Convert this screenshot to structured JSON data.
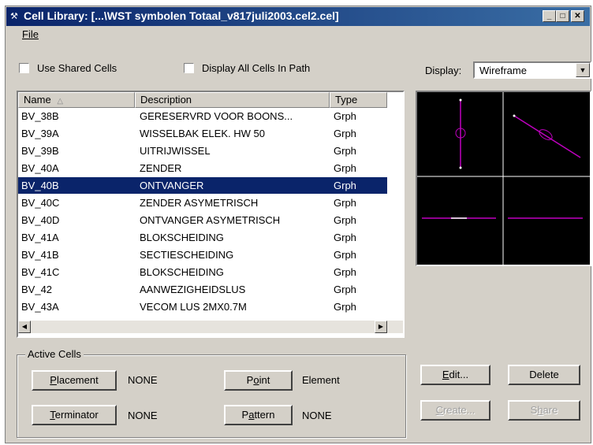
{
  "window": {
    "title": "Cell Library: [...\\WST symbolen Totaal_v817juli2003.cel2.cel]",
    "controls": [
      "minimize",
      "maximize",
      "close"
    ]
  },
  "menu": {
    "file": "File"
  },
  "options": {
    "use_shared_cells": {
      "label": "Use Shared Cells",
      "checked": false
    },
    "display_all_cells": {
      "label": "Display All Cells In Path",
      "checked": false
    }
  },
  "display": {
    "label": "Display:",
    "value": "Wireframe"
  },
  "list": {
    "columns": [
      "Name",
      "Description",
      "Type"
    ],
    "rows": [
      {
        "name": "BV_38B",
        "description": "GERESERVRD VOOR BOONS...",
        "type": "Grph"
      },
      {
        "name": "BV_39A",
        "description": "WISSELBAK ELEK. HW 50",
        "type": "Grph"
      },
      {
        "name": "BV_39B",
        "description": "UITRIJWISSEL",
        "type": "Grph"
      },
      {
        "name": "BV_40A",
        "description": "ZENDER",
        "type": "Grph"
      },
      {
        "name": "BV_40B",
        "description": "ONTVANGER",
        "type": "Grph",
        "selected": true
      },
      {
        "name": "BV_40C",
        "description": "ZENDER ASYMETRISCH",
        "type": "Grph"
      },
      {
        "name": "BV_40D",
        "description": "ONTVANGER ASYMETRISCH",
        "type": "Grph"
      },
      {
        "name": "BV_41A",
        "description": "BLOKSCHEIDING",
        "type": "Grph"
      },
      {
        "name": "BV_41B",
        "description": "SECTIESCHEIDING",
        "type": "Grph"
      },
      {
        "name": "BV_41C",
        "description": "BLOKSCHEIDING",
        "type": "Grph"
      },
      {
        "name": "BV_42",
        "description": "AANWEZIGHEIDSLUS",
        "type": "Grph"
      },
      {
        "name": "BV_43A",
        "description": "VECOM LUS 2MX0.7M",
        "type": "Grph"
      }
    ]
  },
  "active_cells": {
    "title": "Active Cells",
    "placement": {
      "label": "Placement",
      "value": "NONE"
    },
    "terminator": {
      "label": "Terminator",
      "value": "NONE"
    },
    "point": {
      "label": "Point",
      "value": "Element"
    },
    "pattern": {
      "label": "Pattern",
      "value": "NONE"
    }
  },
  "actions": {
    "edit": {
      "label": "Edit...",
      "enabled": true
    },
    "delete": {
      "label": "Delete",
      "enabled": true
    },
    "create": {
      "label": "Create...",
      "enabled": false
    },
    "share": {
      "label": "Share",
      "enabled": false
    }
  },
  "colors": {
    "titlebar": "#0a246a",
    "selection": "#0a246a",
    "preview_bg": "#000000",
    "cell_geometry": "#c000c0"
  }
}
